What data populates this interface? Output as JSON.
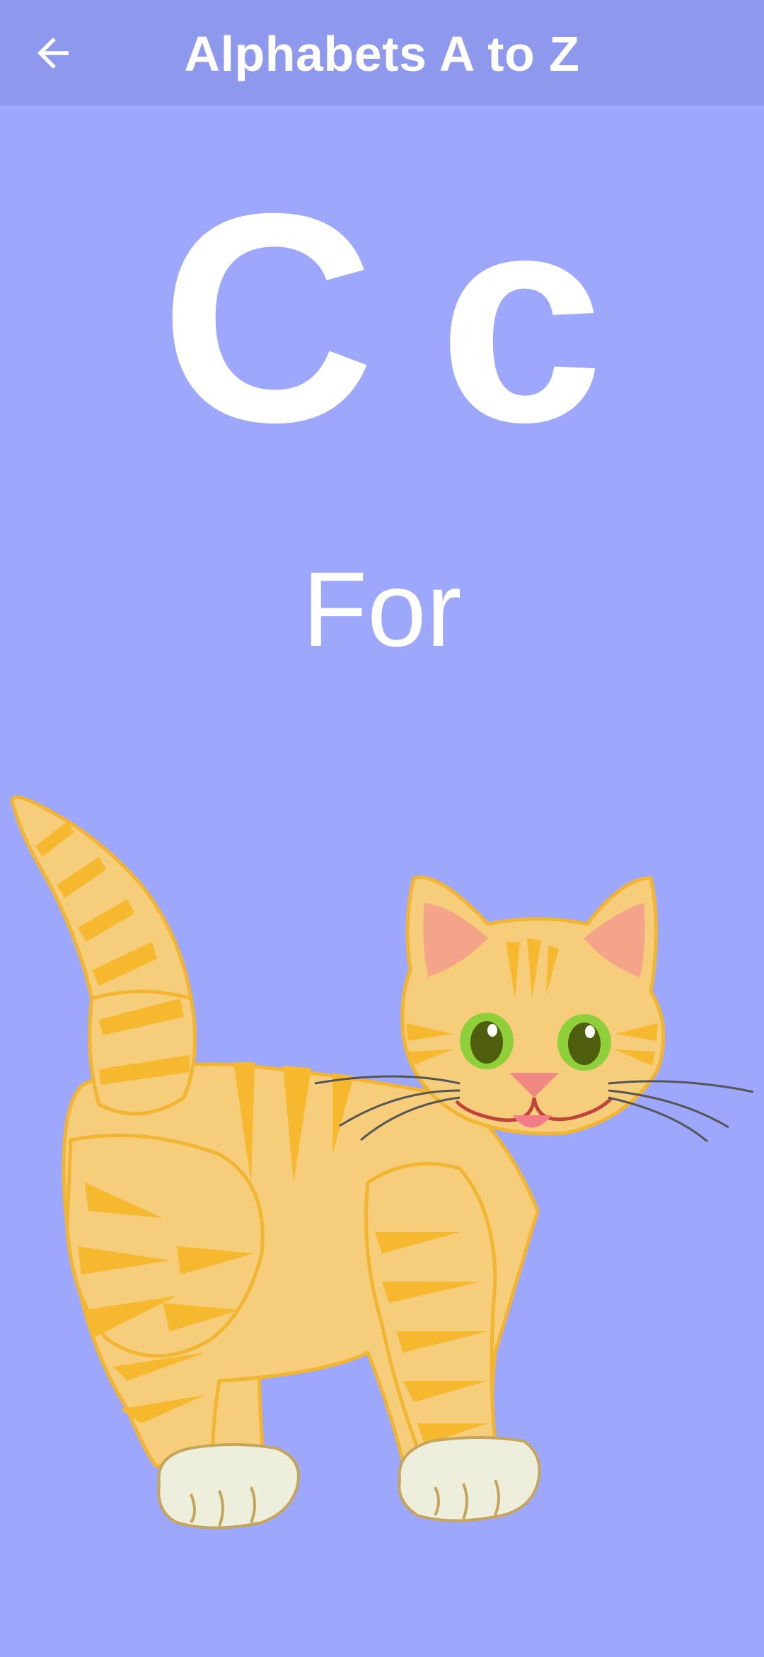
{
  "appbar": {
    "title": "Alphabets A to Z",
    "back_icon": "arrow-left-icon"
  },
  "card": {
    "uppercase": "C",
    "lowercase": "c",
    "word": "For",
    "image_icon": "cat-illustration"
  },
  "colors": {
    "background": "#9da8fc",
    "appbar": "#8e99ee",
    "text": "#ffffff",
    "cat_body": "#f6cd7a",
    "cat_stripes": "#f5b82e"
  }
}
